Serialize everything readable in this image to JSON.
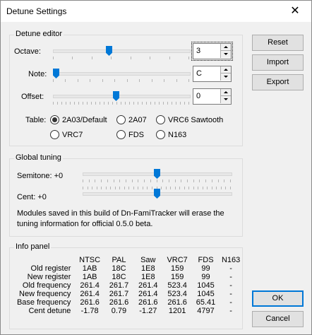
{
  "window": {
    "title": "Detune Settings",
    "close_glyph": "✕"
  },
  "detune_editor": {
    "title": "Detune editor",
    "octave": {
      "label": "Octave:",
      "value": "3"
    },
    "note": {
      "label": "Note:",
      "value": "C"
    },
    "offset": {
      "label": "Offset:",
      "value": "0"
    },
    "table": {
      "label": "Table:",
      "options": [
        {
          "label": "2A03/Default",
          "selected": true
        },
        {
          "label": "2A07",
          "selected": false
        },
        {
          "label": "VRC6 Sawtooth",
          "selected": false
        },
        {
          "label": "VRC7",
          "selected": false
        },
        {
          "label": "FDS",
          "selected": false
        },
        {
          "label": "N163",
          "selected": false
        }
      ]
    }
  },
  "global_tuning": {
    "title": "Global tuning",
    "semitone_label": "Semitone: +0",
    "cent_label": "Cent: +0",
    "note_text_1": "Modules saved in this build of Dn-FamiTracker will erase the",
    "note_text_2": "tuning information for official 0.5.0 beta."
  },
  "info_panel": {
    "title": "Info panel",
    "columns": [
      "NTSC",
      "PAL",
      "Saw",
      "VRC7",
      "FDS",
      "N163"
    ],
    "rows": [
      {
        "label": "Old register",
        "values": [
          "1AB",
          "18C",
          "1E8",
          "159",
          "99",
          "-"
        ]
      },
      {
        "label": "New register",
        "values": [
          "1AB",
          "18C",
          "1E8",
          "159",
          "99",
          "-"
        ]
      },
      {
        "label": "Old frequency",
        "values": [
          "261.4",
          "261.7",
          "261.4",
          "523.4",
          "1045",
          "-"
        ]
      },
      {
        "label": "New frequency",
        "values": [
          "261.4",
          "261.7",
          "261.4",
          "523.4",
          "1045",
          "-"
        ]
      },
      {
        "label": "Base frequency",
        "values": [
          "261.6",
          "261.6",
          "261.6",
          "261.6",
          "65.41",
          "-"
        ]
      },
      {
        "label": "Cent detune",
        "values": [
          "-1.78",
          "0.79",
          "-1.27",
          "1201",
          "4797",
          "-"
        ]
      }
    ]
  },
  "buttons": {
    "reset": "Reset",
    "import": "Import",
    "export": "Export",
    "ok": "OK",
    "cancel": "Cancel"
  },
  "sliders": {
    "octave_fraction": 0.41,
    "note_fraction": 0.0,
    "offset_fraction": 0.46,
    "semitone_fraction": 0.5,
    "cent_fraction": 0.5
  },
  "colors": {
    "accent": "#0078d7"
  }
}
